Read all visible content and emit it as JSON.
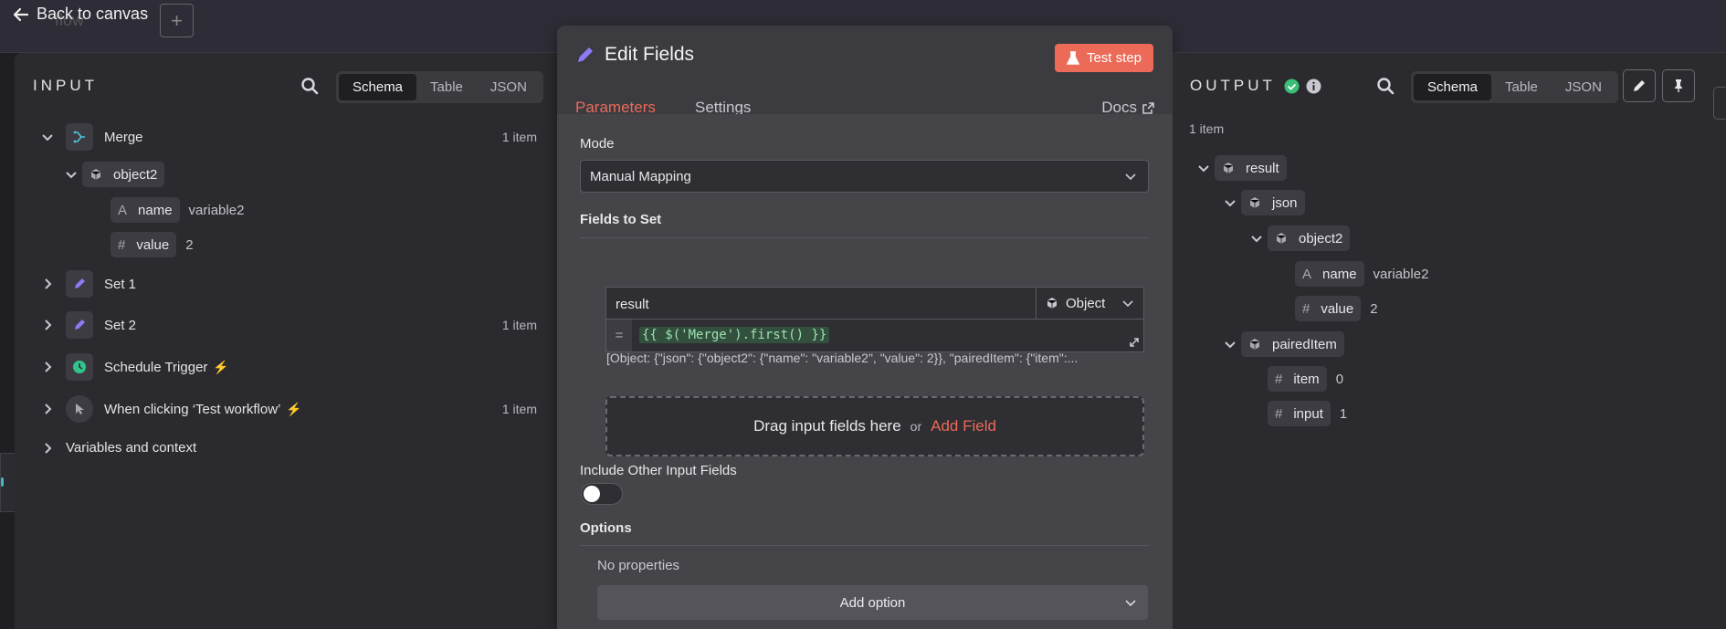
{
  "topbar": {
    "back_label": "Back to canvas",
    "ghost_text": "flow"
  },
  "input": {
    "title": "INPUT",
    "view_tabs": [
      "Schema",
      "Table",
      "JSON"
    ],
    "active_view": "Schema",
    "tree": {
      "merge": {
        "label": "Merge",
        "count": "1 item"
      },
      "object2": {
        "label": "object2"
      },
      "name": {
        "key": "name",
        "value": "variable2"
      },
      "value": {
        "key": "value",
        "value": "2"
      },
      "set1": {
        "label": "Set 1"
      },
      "set2": {
        "label": "Set 2",
        "count": "1 item"
      },
      "schedule": {
        "label": "Schedule Trigger"
      },
      "manual": {
        "label": "When clicking ‘Test workflow’",
        "count": "1 item"
      },
      "vars": {
        "label": "Variables and context"
      }
    }
  },
  "modal": {
    "title": "Edit Fields",
    "test_button": "Test step",
    "tabs": [
      "Parameters",
      "Settings"
    ],
    "docs_label": "Docs",
    "mode_label": "Mode",
    "mode_value": "Manual Mapping",
    "fields_label": "Fields to Set",
    "field_name": "result",
    "field_type": "Object",
    "expr_eq": "=",
    "expression": "{{ $('Merge').first() }}",
    "result_preview": "[Object: {\"json\": {\"object2\": {\"name\": \"variable2\", \"value\": 2}}, \"pairedItem\": {\"item\":...",
    "drop_text": "Drag input fields here",
    "drop_or": "or",
    "add_field": "Add Field",
    "include_label": "Include Other Input Fields",
    "include_enabled": false,
    "options_label": "Options",
    "no_properties": "No properties",
    "add_option": "Add option"
  },
  "output": {
    "title": "OUTPUT",
    "view_tabs": [
      "Schema",
      "Table",
      "JSON"
    ],
    "active_view": "Schema",
    "item_count": "1 item",
    "tree": {
      "result": "result",
      "json": "json",
      "object2": "object2",
      "name": {
        "key": "name",
        "value": "variable2"
      },
      "value": {
        "key": "value",
        "value": "2"
      },
      "paired": "pairedItem",
      "item": {
        "key": "item",
        "value": "0"
      },
      "input": {
        "key": "input",
        "value": "1"
      }
    }
  },
  "colors": {
    "accent": "#ec6a58",
    "success": "#3dbe78",
    "panel": "#2b2b2f",
    "modal": "#3b3b40"
  }
}
